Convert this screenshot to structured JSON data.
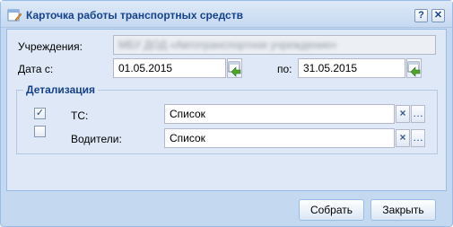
{
  "window": {
    "title": "Карточка работы транспортных средств",
    "help_label": "?",
    "close_label": "✕"
  },
  "form": {
    "institution_label": "Учреждения:",
    "institution_value": "МБУ ДОД «Автотранспортное учреждение»",
    "date_from_label": "Дата с:",
    "date_from_value": "01.05.2015",
    "date_to_label": "по:",
    "date_to_value": "31.05.2015"
  },
  "detail": {
    "legend": "Детализация",
    "rows": [
      {
        "label": "ТС:",
        "checked": true,
        "check_glyph": "✓",
        "value": "Список",
        "clear_glyph": "×",
        "more_glyph": "…"
      },
      {
        "label": "Водители:",
        "checked": false,
        "check_glyph": "",
        "value": "Список",
        "clear_glyph": "×",
        "more_glyph": "…"
      }
    ]
  },
  "footer": {
    "collect_label": "Собрать",
    "close_label": "Закрыть"
  },
  "colors": {
    "title_text": "#15428b",
    "window_bg": "#c4d8ef",
    "panel_bg": "#dfe8f6"
  },
  "icons": [
    "window-form-icon",
    "calendar-icon",
    "clear-icon",
    "ellipsis-icon"
  ]
}
